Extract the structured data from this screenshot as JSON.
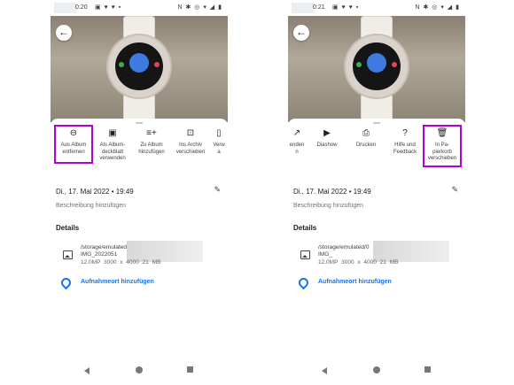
{
  "left": {
    "status_time": "0:20",
    "status_icons_left": "▣ ♥ ♥ ▪",
    "status_icons_right": "N ✱ ◎ ▾ ◢ ▮",
    "actions": [
      {
        "icon": "remove-circle-icon",
        "glyph": "⊖",
        "label": "Aus Album\nentfernen"
      },
      {
        "icon": "album-cover-icon",
        "glyph": "▣",
        "label": "Als Album-\ndeckblatt\nverwenden"
      },
      {
        "icon": "playlist-add-icon",
        "glyph": "≡+",
        "label": "Zu Album\nhinzufügen"
      },
      {
        "icon": "archive-icon",
        "glyph": "⊡",
        "label": "Ins Archiv\nverschieben"
      },
      {
        "icon": "partial-icon",
        "glyph": "▯",
        "label": "Verw\na"
      }
    ],
    "date": "Di., 17. Mai 2022 • 19:49",
    "description_placeholder": "Beschreibung hinzufügen",
    "details_heading": "Details",
    "file_path_1": "/storage/emulated/",
    "file_path_2": "IMG_2022051",
    "file_meta": "12.0MP  3000 x 4000  21 MB",
    "location_link": "Aufnahmeort hinzufügen"
  },
  "right": {
    "status_time": "0:21",
    "status_icons_left": "▣ ♥ ♥ ▪",
    "status_icons_right": "N ✱ ◎ ▾ ◢ ▮",
    "actions": [
      {
        "icon": "share-partial-icon",
        "glyph": "↗",
        "label": "enden\nn"
      },
      {
        "icon": "slideshow-icon",
        "glyph": "▶",
        "label": "Diashow"
      },
      {
        "icon": "print-icon",
        "glyph": "⎙",
        "label": "Drucken"
      },
      {
        "icon": "help-icon",
        "glyph": "?",
        "label": "Hilfe und\nFeedback"
      },
      {
        "icon": "trash-icon",
        "glyph": "🗑",
        "label": "In Pa-\npierkorb\nverschieben"
      }
    ],
    "date": "Di., 17. Mai 2022 • 19:49",
    "description_placeholder": "Beschreibung hinzufügen",
    "details_heading": "Details",
    "file_path_1": "/storage/emulated/0",
    "file_path_2": "IMG_",
    "file_meta": "12.0MP  3000 x 4000  21 MB",
    "location_link": "Aufnahmeort hinzufügen"
  },
  "highlight_color": "#b000d6",
  "accent_color": "#1a73e8"
}
